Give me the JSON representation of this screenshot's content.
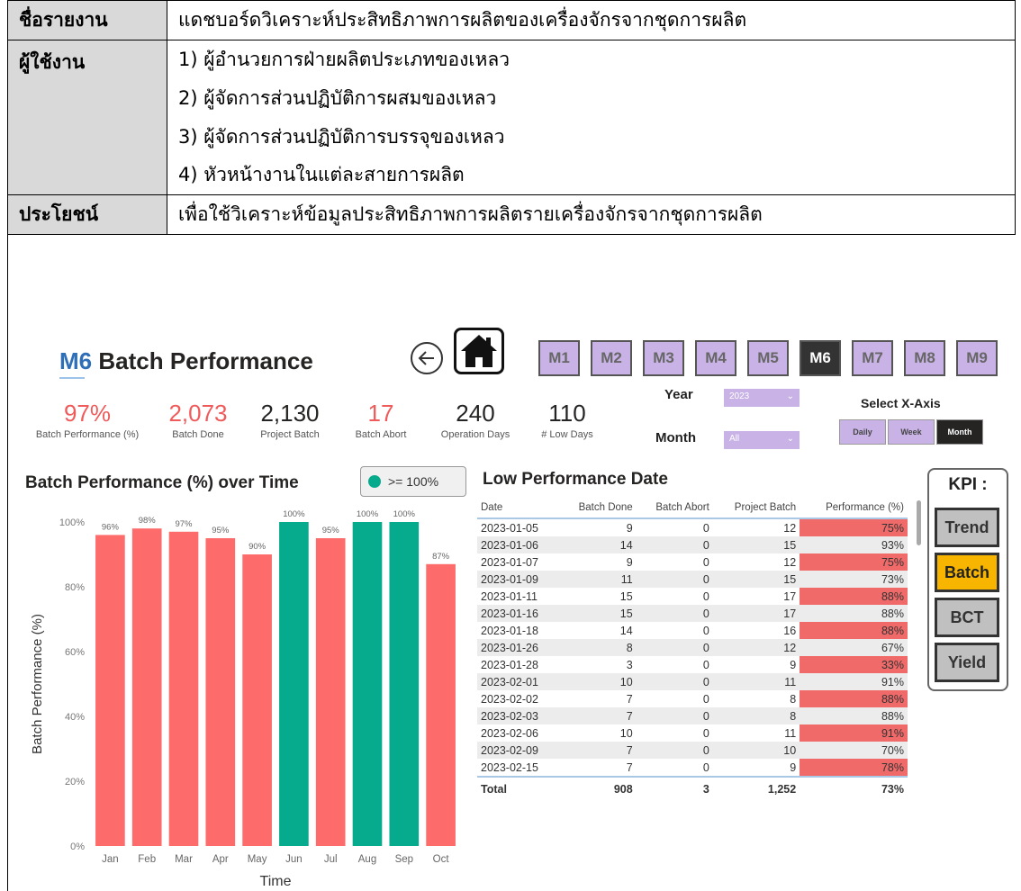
{
  "info": {
    "rows": [
      {
        "header": "ชื่อรายงาน",
        "value": "แดชบอร์ดวิเคราะห์ประสิทธิภาพการผลิตของเครื่องจักรจากชุดการผลิต"
      },
      {
        "header": "ผู้ใช้งาน",
        "values": [
          "1) ผู้อำนวยการฝ่ายผลิตประเภทของเหลว",
          "2) ผู้จัดการส่วนปฏิบัติการผสมของเหลว",
          "3) ผู้จัดการส่วนปฏิบัติการบรรจุของเหลว",
          "4) หัวหน้างานในแต่ละสายการผลิต"
        ]
      },
      {
        "header": "ประโยชน์",
        "value": "เพื่อใช้วิเคราะห์ข้อมูลประสิทธิภาพการผลิตรายเครื่องจักรจากชุดการผลิต"
      }
    ]
  },
  "dashboard": {
    "title_prefix": "M6",
    "title_rest": "Batch Performance",
    "machines": [
      "M1",
      "M2",
      "M3",
      "M4",
      "M5",
      "M6",
      "M7",
      "M8",
      "M9"
    ],
    "active_machine": "M6",
    "kpis": [
      {
        "value": "97%",
        "label": "Batch Performance (%)",
        "color": "#f05a5a"
      },
      {
        "value": "2,073",
        "label": "Batch Done",
        "color": "#f05a5a"
      },
      {
        "value": "2,130",
        "label": "Project Batch",
        "color": "#252423"
      },
      {
        "value": "17",
        "label": "Batch Abort",
        "color": "#f05a5a"
      },
      {
        "value": "240",
        "label": "Operation Days",
        "color": "#252423"
      },
      {
        "value": "110",
        "label": "# Low Days",
        "color": "#252423"
      }
    ],
    "filters": {
      "year_label": "Year",
      "year_value": "2023",
      "month_label": "Month",
      "month_value": "All"
    },
    "xaxis": {
      "label": "Select X-Axis",
      "options": [
        "Daily",
        "Week",
        "Month"
      ],
      "selected": "Month"
    },
    "chart_title": "Batch Performance (%) over Time",
    "legend_label": ">= 100%",
    "table": {
      "title": "Low Performance Date",
      "columns": [
        "Date",
        "Batch Done",
        "Batch Abort",
        "Project Batch",
        "Performance (%)"
      ],
      "rows": [
        [
          "2023-01-05",
          "9",
          "0",
          "12",
          "75%"
        ],
        [
          "2023-01-06",
          "14",
          "0",
          "15",
          "93%"
        ],
        [
          "2023-01-07",
          "9",
          "0",
          "12",
          "75%"
        ],
        [
          "2023-01-09",
          "11",
          "0",
          "15",
          "73%"
        ],
        [
          "2023-01-11",
          "15",
          "0",
          "17",
          "88%"
        ],
        [
          "2023-01-16",
          "15",
          "0",
          "17",
          "88%"
        ],
        [
          "2023-01-18",
          "14",
          "0",
          "16",
          "88%"
        ],
        [
          "2023-01-26",
          "8",
          "0",
          "12",
          "67%"
        ],
        [
          "2023-01-28",
          "3",
          "0",
          "9",
          "33%"
        ],
        [
          "2023-02-01",
          "10",
          "0",
          "11",
          "91%"
        ],
        [
          "2023-02-02",
          "7",
          "0",
          "8",
          "88%"
        ],
        [
          "2023-02-03",
          "7",
          "0",
          "8",
          "88%"
        ],
        [
          "2023-02-06",
          "10",
          "0",
          "11",
          "91%"
        ],
        [
          "2023-02-09",
          "7",
          "0",
          "10",
          "70%"
        ],
        [
          "2023-02-15",
          "7",
          "0",
          "9",
          "78%"
        ]
      ],
      "total": [
        "Total",
        "908",
        "3",
        "1,252",
        "73%"
      ]
    },
    "kpi_panel": {
      "title": "KPI :",
      "buttons": [
        "Trend",
        "Batch",
        "BCT",
        "Yield"
      ],
      "selected": "Batch"
    }
  },
  "chart_data": {
    "type": "bar",
    "title": "Batch Performance (%) over Time",
    "xlabel": "Time",
    "ylabel": "Batch Performance (%)",
    "categories": [
      "Jan",
      "Feb",
      "Mar",
      "Apr",
      "May",
      "Jun",
      "Jul",
      "Aug",
      "Sep",
      "Oct"
    ],
    "values": [
      96,
      98,
      97,
      95,
      90,
      100,
      95,
      100,
      100,
      87
    ],
    "labels": [
      "96%",
      "98%",
      "97%",
      "95%",
      "90%",
      "100%",
      "95%",
      "100%",
      "100%",
      "87%"
    ],
    "ylim": [
      0,
      100
    ],
    "yticks": [
      "0%",
      "20%",
      "40%",
      "60%",
      "80%",
      "100%"
    ],
    "colors": {
      "below": "#fd6b6b",
      "at_or_above": "#05ab8c"
    },
    "legend": ">= 100%"
  }
}
